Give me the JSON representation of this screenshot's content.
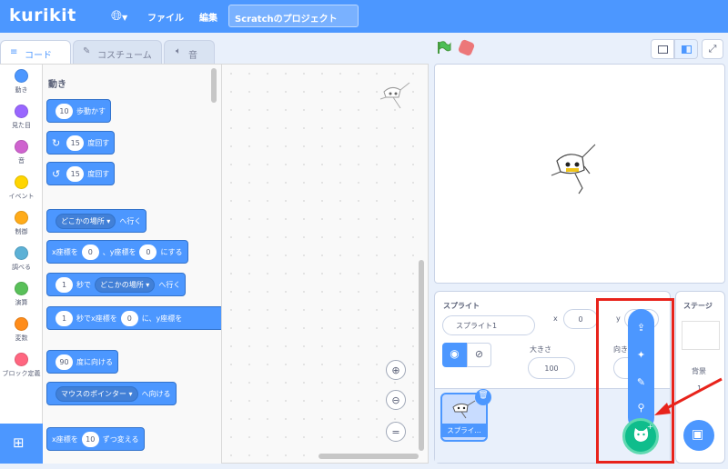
{
  "menubar": {
    "logo": "kurikit",
    "file": "ファイル",
    "edit": "編集",
    "project_title": "Scratchのプロジェクト"
  },
  "tabs": {
    "code": "コード",
    "costume": "コスチューム",
    "sound": "音"
  },
  "categories": [
    {
      "label": "動き",
      "color": "#4c97ff"
    },
    {
      "label": "見た目",
      "color": "#9966ff"
    },
    {
      "label": "音",
      "color": "#cf63cf"
    },
    {
      "label": "イベント",
      "color": "#ffd500"
    },
    {
      "label": "制御",
      "color": "#ffab19"
    },
    {
      "label": "調べる",
      "color": "#5cb1d6"
    },
    {
      "label": "演算",
      "color": "#59c059"
    },
    {
      "label": "変数",
      "color": "#ff8c1a"
    },
    {
      "label": "ブロック定義",
      "color": "#ff6680"
    }
  ],
  "palette": {
    "heading": "動き",
    "move_steps": "10",
    "move_label": "歩動かす",
    "turn_right_deg": "15",
    "turn_label": "度回す",
    "turn_left_deg": "15",
    "goto_target": "どこかの場所",
    "goto_label": "へ行く",
    "gotoxy_x_label": "x座標を",
    "gotoxy_x": "0",
    "gotoxy_y_label": "、y座標を",
    "gotoxy_y": "0",
    "gotoxy_end": "にする",
    "glide_secs": "1",
    "glide_label": "秒で",
    "glide_target": "どこかの場所",
    "glide_end": "へ行く",
    "glide2_secs": "1",
    "glide2_label": "秒でx座標を",
    "glide2_x": "0",
    "glide2_y_label": "に、y座標を",
    "point_dir": "90",
    "point_label": "度に向ける",
    "point_towards": "マウスのポインター",
    "point_towards_label": "へ向ける",
    "changex_label": "x座標を",
    "changex_val": "10",
    "changex_end": "ずつ変える"
  },
  "sprite_info": {
    "title": "スプライト",
    "name": "スプライト1",
    "x_label": "x",
    "x": "0",
    "y_label": "y",
    "y": "0",
    "size_label": "大きさ",
    "size": "100",
    "direction_label": "向き",
    "thumb_label": "スプライ…"
  },
  "stage_panel": {
    "title": "ステージ",
    "backdrop_label": "背景",
    "backdrop_count": "1"
  },
  "colors": {
    "accent": "#4c97ff",
    "highlight": "#e8231b",
    "choose_sprite": "#0fbd8c"
  }
}
